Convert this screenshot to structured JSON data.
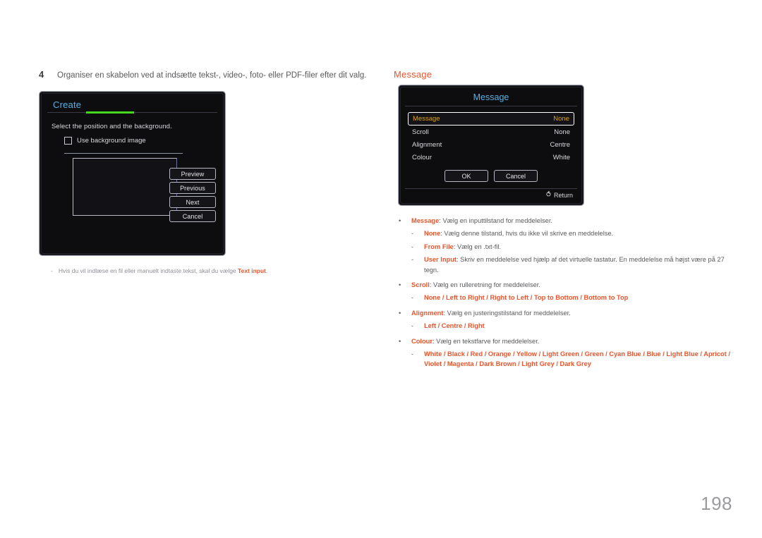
{
  "page": {
    "number": "198"
  },
  "left": {
    "step": {
      "number": "4",
      "text": "Organiser en skabelon ved at indsætte tekst-, video-, foto- eller PDF-filer efter dit valg."
    },
    "create_dialog": {
      "title": "Create",
      "instruction": "Select the position and the background.",
      "checkbox_label": "Use background image",
      "buttons": [
        "Preview",
        "Previous",
        "Next",
        "Cancel"
      ]
    },
    "note": {
      "marker": "-",
      "text_before": "Hvis du vil indlæse en fil eller manuelt indtaste tekst, skal du vælge ",
      "highlight": "Text input",
      "text_after": "."
    }
  },
  "right": {
    "section_title": "Message",
    "message_dialog": {
      "title": "Message",
      "rows": [
        {
          "label": "Message",
          "value": "None",
          "selected": true
        },
        {
          "label": "Scroll",
          "value": "None",
          "selected": false
        },
        {
          "label": "Alignment",
          "value": "Centre",
          "selected": false
        },
        {
          "label": "Colour",
          "value": "White",
          "selected": false
        }
      ],
      "ok_label": "OK",
      "cancel_label": "Cancel",
      "return_label": "Return",
      "return_icon": "return-arrow-icon"
    },
    "bullets": [
      {
        "mark": "•",
        "term": "Message",
        "desc": ": Vælg en inputtilstand for meddelelser.",
        "children": [
          {
            "mark": "-",
            "term": "None",
            "desc": ": Vælg denne tilstand, hvis du ikke vil skrive en meddelelse."
          },
          {
            "mark": "-",
            "term": "From File",
            "desc": ": Vælg en .txt-fil."
          },
          {
            "mark": "-",
            "term": "User Input",
            "desc": ": Skriv en meddelelse ved hjælp af det virtuelle tastatur. En meddelelse må højst være på 27 tegn."
          }
        ]
      },
      {
        "mark": "•",
        "term": "Scroll",
        "desc": ": Vælg en rulleretning for meddelelser.",
        "children": [
          {
            "mark": "-",
            "options": "None / Left to Right / Right to Left / Top to Bottom / Bottom to Top"
          }
        ]
      },
      {
        "mark": "•",
        "term": "Alignment",
        "desc": ": Vælg en justeringstilstand for meddelelser.",
        "children": [
          {
            "mark": "-",
            "options": "Left / Centre / Right"
          }
        ]
      },
      {
        "mark": "•",
        "term": "Colour",
        "desc": ": Vælg en tekstfarve for meddelelser.",
        "children": [
          {
            "mark": "-",
            "options": "White / Black / Red / Orange / Yellow / Light Green / Green / Cyan Blue / Blue / Light Blue / Apricot / Violet / Magenta / Dark Brown / Light Grey / Dark Grey"
          }
        ]
      }
    ]
  },
  "colors": {
    "accent_orange": "#e8552d",
    "osd_blue": "#59b0e6",
    "osd_green": "#46d81f",
    "osd_selected_text": "#e2a300",
    "body_text": "#58595b"
  }
}
